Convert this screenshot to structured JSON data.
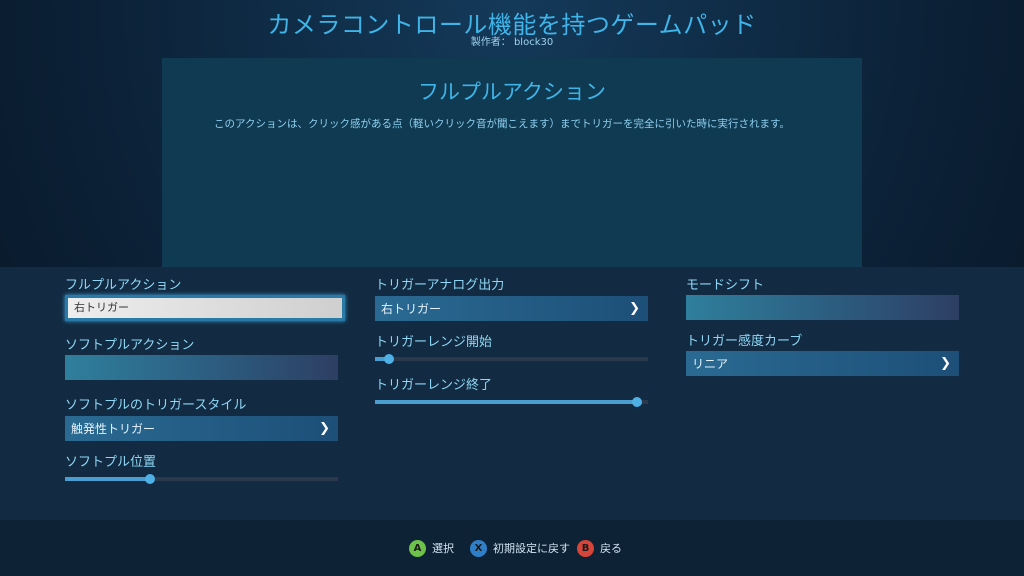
{
  "header": {
    "title": "カメラコントロール機能を持つゲームパッド",
    "author": "製作者： block30"
  },
  "info": {
    "title": "フルプルアクション",
    "description": "このアクションは、クリック感がある点（軽いクリック音が聞こえます）までトリガーを完全に引いた時に実行されます。"
  },
  "left": {
    "full_pull_label": "フルプルアクション",
    "full_pull_value": "右トリガー",
    "soft_pull_label": "ソフトプルアクション",
    "soft_pull_style_label": "ソフトプルのトリガースタイル",
    "soft_pull_style_value": "触発性トリガー",
    "soft_pull_position_label": "ソフトプル位置",
    "soft_pull_position": 0.31
  },
  "middle": {
    "analog_output_label": "トリガーアナログ出力",
    "analog_output_value": "右トリガー",
    "range_start_label": "トリガーレンジ開始",
    "range_start": 0.05,
    "range_end_label": "トリガーレンジ終了",
    "range_end": 0.96
  },
  "right": {
    "mode_shift_label": "モードシフト",
    "curve_label": "トリガー感度カーブ",
    "curve_value": "リニア"
  },
  "footer": {
    "select_key": "A",
    "select_label": "選択",
    "reset_key": "X",
    "reset_label": "初期設定に戻す",
    "back_key": "B",
    "back_label": "戻る"
  },
  "colors": {
    "accent": "#3fb4e8",
    "button_a": "#6cc24a",
    "button_x": "#2f7fc8",
    "button_b": "#d6453a"
  },
  "icons": {
    "dropdown": "chevron-down-icon"
  }
}
